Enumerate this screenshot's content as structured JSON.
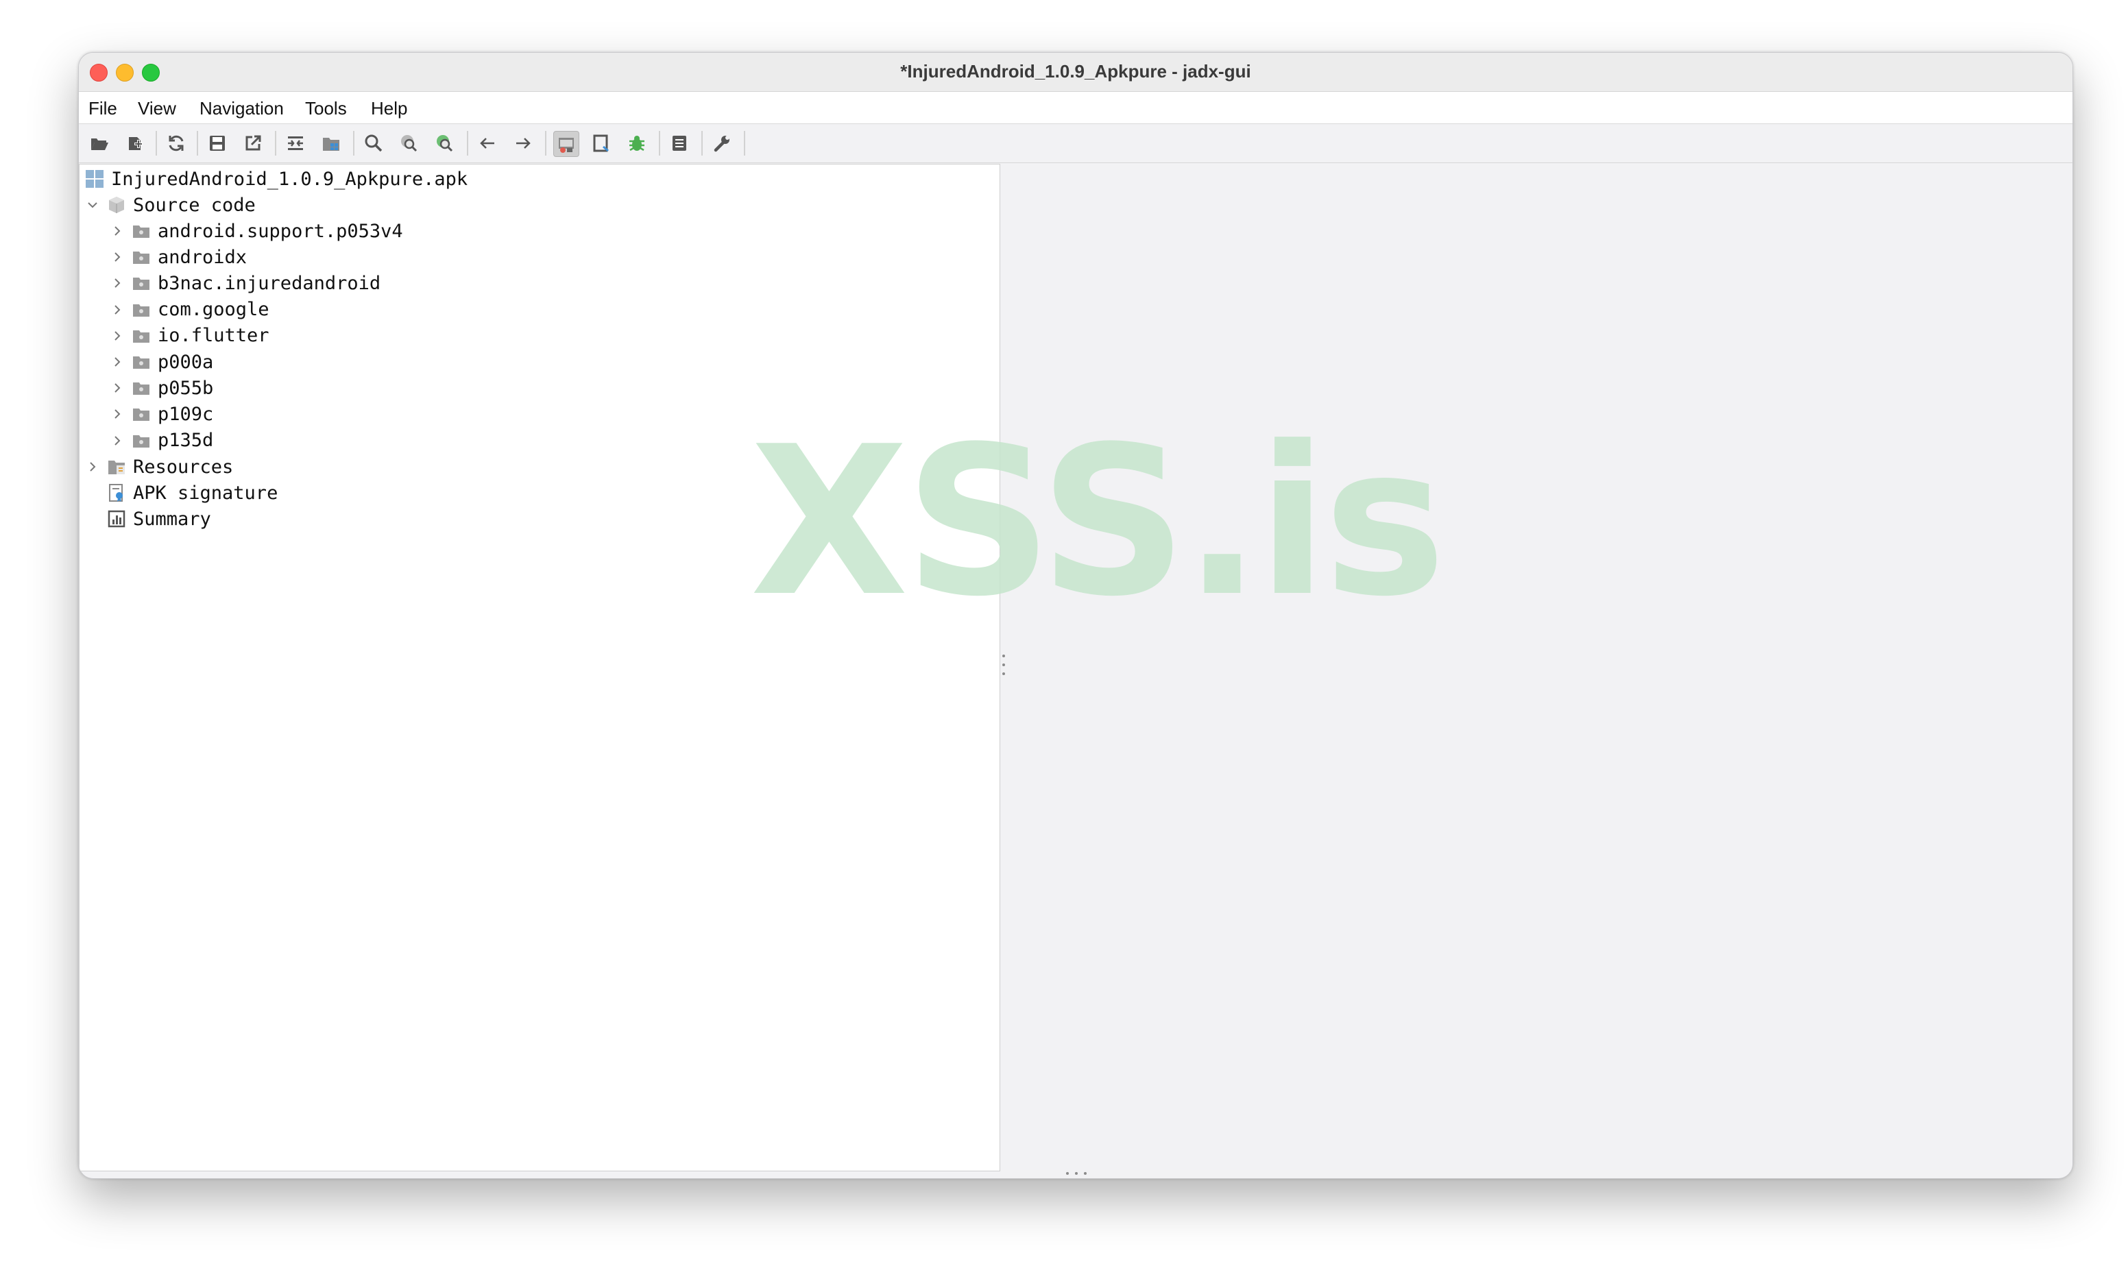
{
  "window": {
    "title": "*InjuredAndroid_1.0.9_Apkpure - jadx-gui"
  },
  "menu": [
    "File",
    "View",
    "Navigation",
    "Tools",
    "Help"
  ],
  "toolbar": {
    "icons": [
      "open-file-icon",
      "add-files-icon",
      "sync-icon",
      "save-icon",
      "export-icon",
      "flatten-icon",
      "package-icon",
      "search-icon",
      "search-class-icon",
      "search-usage-icon",
      "back-arrow-icon",
      "forward-arrow-icon",
      "deobfuscation-icon",
      "decompile-icon",
      "debug-bug-icon",
      "log-viewer-icon",
      "preferences-wrench-icon"
    ]
  },
  "tree": {
    "root": "InjuredAndroid_1.0.9_Apkpure.apk",
    "source_code": "Source code",
    "packages": [
      "android.support.p053v4",
      "androidx",
      "b3nac.injuredandroid",
      "com.google",
      "io.flutter",
      "p000a",
      "p055b",
      "p109c",
      "p135d"
    ],
    "resources": "Resources",
    "apk_signature": "APK signature",
    "summary": "Summary"
  },
  "watermark": "XSS.is",
  "colors": {
    "close": "#fe5f57",
    "minimize": "#febc2e",
    "maximize": "#28c840",
    "watermark": "#c6e6cd"
  }
}
